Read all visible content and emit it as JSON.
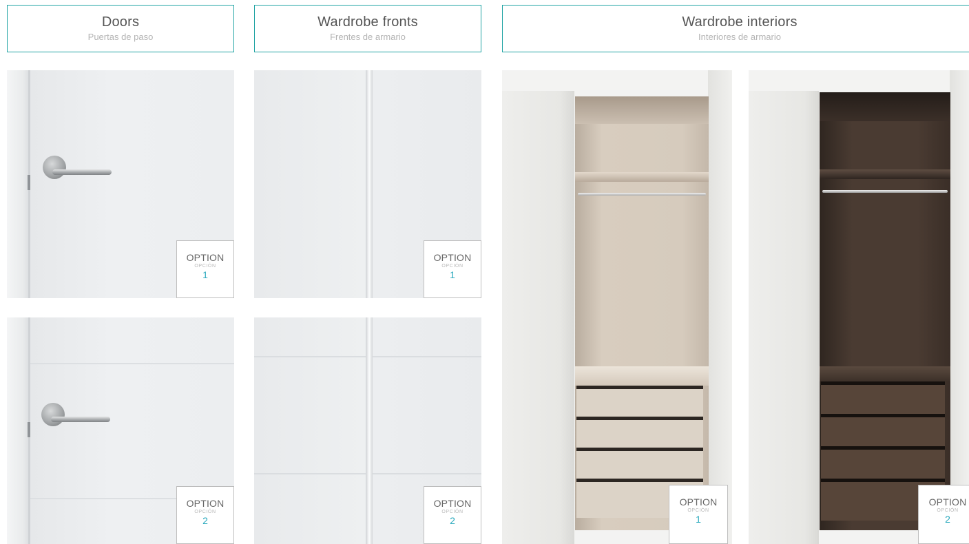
{
  "headers": {
    "doors": {
      "title": "Doors",
      "subtitle": "Puertas de paso"
    },
    "wardrobe_fronts": {
      "title": "Wardrobe fronts",
      "subtitle": "Frentes de armario"
    },
    "wardrobe_interiors": {
      "title": "Wardrobe interiors",
      "subtitle": "Interiores de armario"
    }
  },
  "badge": {
    "label_en": "OPTION",
    "label_es": "OPCIÓN"
  },
  "options": {
    "door_1": "1",
    "door_2": "2",
    "front_1": "1",
    "front_2": "2",
    "interior_1": "1",
    "interior_2": "2"
  },
  "colors": {
    "header_border": "#1fa3a3",
    "option_number": "#29a9bd",
    "interior_light": "#d6cbbd",
    "interior_dark": "#4a3b32"
  }
}
